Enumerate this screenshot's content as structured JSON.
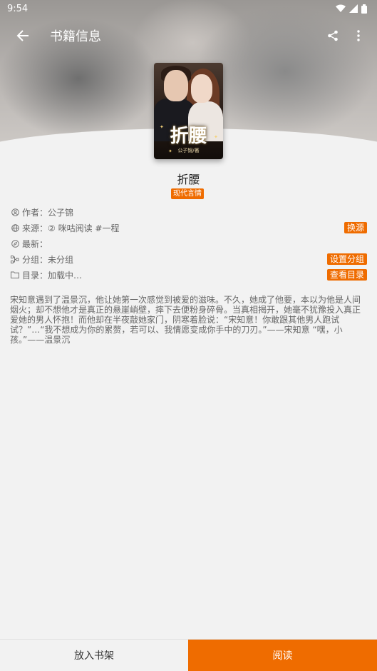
{
  "status_bar": {
    "time": "9:54"
  },
  "app_bar": {
    "title": "书籍信息"
  },
  "book": {
    "cover_title": "折腰",
    "cover_author": "公子锦/著",
    "name": "折腰",
    "tag": "现代言情"
  },
  "info": {
    "author_label": "作者：",
    "author": "公子锦",
    "source_label": "来源：",
    "source": "② 咪咕阅读 #一程",
    "change_source_btn": "换源",
    "latest_label": "最新：",
    "latest": "",
    "group_label": "分组：",
    "group": "未分组",
    "set_group_btn": "设置分组",
    "toc_label": "目录：",
    "toc": "加载中…",
    "view_toc_btn": "查看目录"
  },
  "description": "宋知意遇到了温景沉，他让她第一次感觉到被爱的滋味。不久，她成了他要，本以为他是人间烟火；却不想他才是真正的悬崖峭壁，摔下去便粉身碎骨。当真相揭开，她毫不犹豫投入真正爱她的男人怀抱！而他却在半夜敲她家门，阴寒着脸说：“宋知意！你敢跟其他男人跑试试？”…“我不想成为你的累赘，若可以、我情愿变成你手中的刀刃。”——宋知意 “嘿，小孩。”——温景沉",
  "bottom_bar": {
    "add_shelf": "放入书架",
    "read": "阅读"
  },
  "colors": {
    "accent": "#ef6c00",
    "background": "#f2f2f2"
  }
}
